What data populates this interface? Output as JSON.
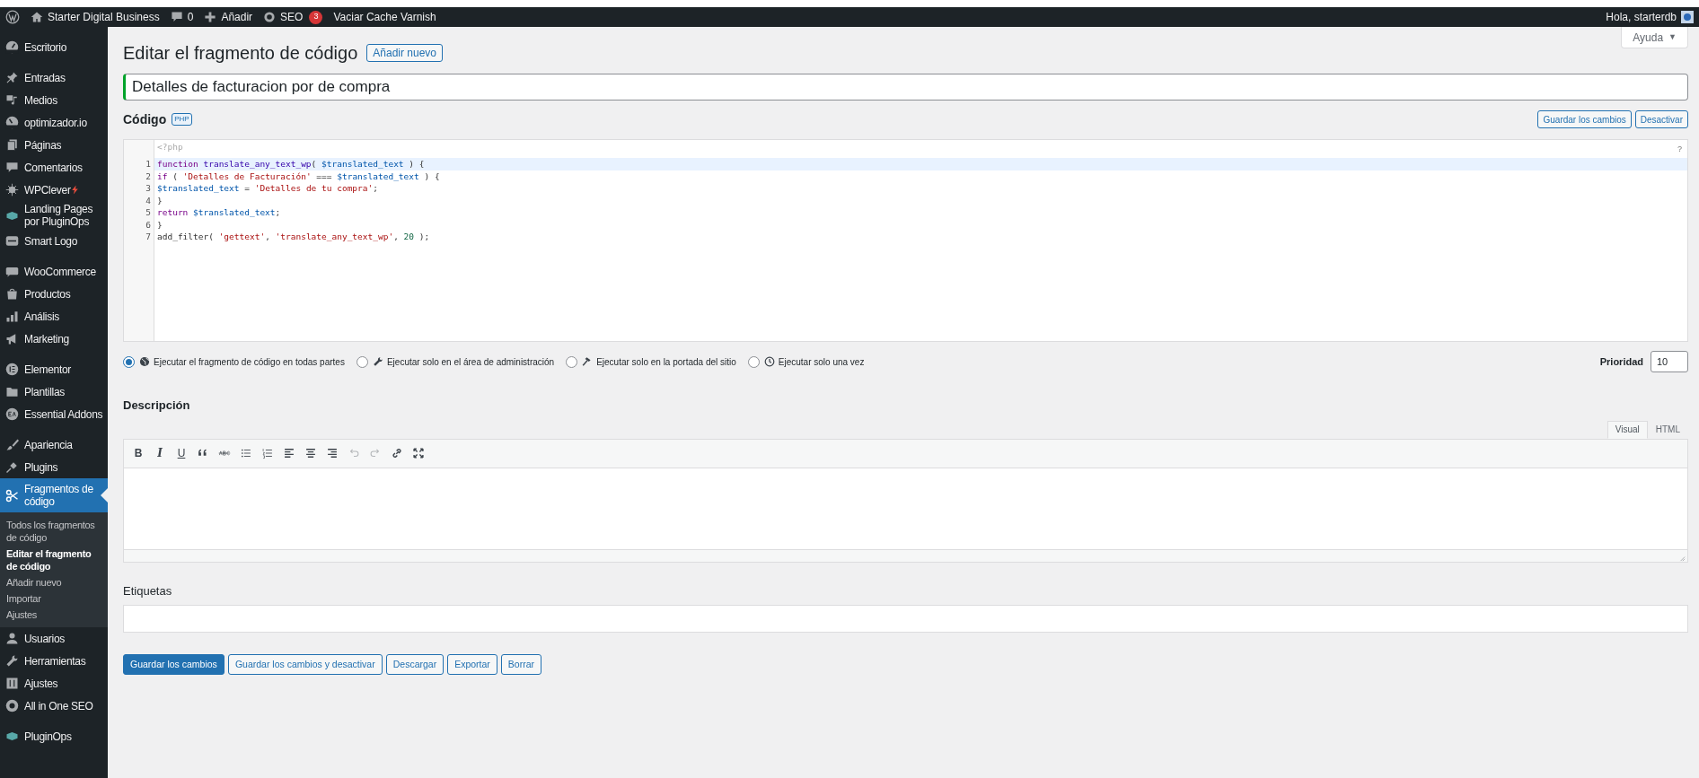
{
  "admin_bar": {
    "site": "Starter Digital Business",
    "comments": "0",
    "new": "Añadir",
    "seo": "SEO",
    "seo_badge": "3",
    "cache": "Vaciar Cache Varnish",
    "greeting": "Hola, starterdb"
  },
  "sidebar": {
    "groups": [
      [
        {
          "label": "Escritorio",
          "selected": false
        }
      ],
      [
        {
          "label": "Entradas",
          "selected": false
        },
        {
          "label": "Medios",
          "selected": false
        },
        {
          "label": "optimizador.io",
          "selected": false
        },
        {
          "label": "Páginas",
          "selected": false
        },
        {
          "label": "Comentarios",
          "selected": false
        },
        {
          "label": "WPClever",
          "selected": false
        },
        {
          "label": "Landing Pages por PluginOps",
          "selected": false
        },
        {
          "label": "Smart Logo",
          "selected": false
        }
      ],
      [
        {
          "label": "WooCommerce",
          "selected": false
        },
        {
          "label": "Productos",
          "selected": false
        },
        {
          "label": "Análisis",
          "selected": false
        },
        {
          "label": "Marketing",
          "selected": false
        }
      ],
      [
        {
          "label": "Elementor",
          "selected": false
        },
        {
          "label": "Plantillas",
          "selected": false
        },
        {
          "label": "Essential Addons",
          "selected": false
        }
      ],
      [
        {
          "label": "Apariencia",
          "selected": false
        },
        {
          "label": "Plugins",
          "selected": false
        },
        {
          "label": "Fragmentos de código",
          "selected": true,
          "children": [
            {
              "label": "Todos los fragmentos de código",
              "selected": false
            },
            {
              "label": "Editar el fragmento de código",
              "selected": true
            },
            {
              "label": "Añadir nuevo",
              "selected": false
            },
            {
              "label": "Importar",
              "selected": false
            },
            {
              "label": "Ajustes",
              "selected": false
            }
          ]
        },
        {
          "label": "Usuarios",
          "selected": false
        },
        {
          "label": "Herramientas",
          "selected": false
        },
        {
          "label": "Ajustes",
          "selected": false
        },
        {
          "label": "All in One SEO",
          "selected": false
        }
      ],
      [
        {
          "label": "PluginOps",
          "selected": false
        }
      ]
    ]
  },
  "help_tab": {
    "label": "Ayuda",
    "caret": "▼"
  },
  "page": {
    "title": "Editar el fragmento de código",
    "add_new": "Añadir nuevo"
  },
  "snippet_title": "Detalles de facturacion por de compra",
  "code": {
    "heading": "Código",
    "badge": "PHP",
    "buttons": [
      "Guardar los cambios",
      "Desactivar"
    ],
    "prefix": "<?php",
    "help": "?",
    "lines": [
      {
        "number": "1",
        "highlighted": true,
        "tokens": [
          {
            "kind": "keyword",
            "text": "function"
          },
          {
            "kind": "def",
            "text": " translate_any_text_wp"
          },
          {
            "kind": "plain",
            "text": "( "
          },
          {
            "kind": "variable",
            "text": "$translated_text"
          },
          {
            "kind": "plain",
            "text": " ) {"
          }
        ]
      },
      {
        "number": "2",
        "highlighted": false,
        "tokens": [
          {
            "kind": "keyword",
            "text": "if"
          },
          {
            "kind": "plain",
            "text": " ( "
          },
          {
            "kind": "string",
            "text": "'Detalles de Facturación'"
          },
          {
            "kind": "plain",
            "text": " === "
          },
          {
            "kind": "variable",
            "text": "$translated_text"
          },
          {
            "kind": "plain",
            "text": " ) {"
          }
        ]
      },
      {
        "number": "3",
        "highlighted": false,
        "tokens": [
          {
            "kind": "variable",
            "text": "$translated_text"
          },
          {
            "kind": "plain",
            "text": " = "
          },
          {
            "kind": "string",
            "text": "'Detalles de tu compra'"
          },
          {
            "kind": "plain",
            "text": ";"
          }
        ]
      },
      {
        "number": "4",
        "highlighted": false,
        "tokens": [
          {
            "kind": "plain",
            "text": "}"
          }
        ]
      },
      {
        "number": "5",
        "highlighted": false,
        "tokens": [
          {
            "kind": "keyword",
            "text": "return"
          },
          {
            "kind": "variable",
            "text": " $translated_text"
          },
          {
            "kind": "plain",
            "text": ";"
          }
        ]
      },
      {
        "number": "6",
        "highlighted": false,
        "tokens": [
          {
            "kind": "plain",
            "text": "}"
          }
        ]
      },
      {
        "number": "7",
        "highlighted": false,
        "tokens": [
          {
            "kind": "plain",
            "text": "add_filter( "
          },
          {
            "kind": "string",
            "text": "'gettext'"
          },
          {
            "kind": "plain",
            "text": ", "
          },
          {
            "kind": "string",
            "text": "'translate_any_text_wp'"
          },
          {
            "kind": "plain",
            "text": ", "
          },
          {
            "kind": "number",
            "text": "20"
          },
          {
            "kind": "plain",
            "text": " );"
          }
        ]
      }
    ]
  },
  "scope": {
    "options": [
      {
        "label": "Ejecutar el fragmento de código en todas partes",
        "selected": true
      },
      {
        "label": "Ejecutar solo en el área de administración",
        "selected": false
      },
      {
        "label": "Ejecutar solo en la portada del sitio",
        "selected": false
      },
      {
        "label": "Ejecutar solo una vez",
        "selected": false
      }
    ],
    "priority_label": "Prioridad",
    "priority": "10"
  },
  "description": {
    "heading": "Descripción",
    "tabs": [
      {
        "label": "Visual",
        "selected": true
      },
      {
        "label": "HTML",
        "selected": false
      }
    ],
    "toolbar": [
      {
        "kind": "text",
        "label": "B",
        "disabled": false
      },
      {
        "kind": "text",
        "label": "I",
        "disabled": false
      },
      {
        "kind": "text",
        "label": "U",
        "disabled": false
      },
      {
        "kind": "quote",
        "disabled": false
      },
      {
        "kind": "strike",
        "disabled": false
      },
      {
        "kind": "ul",
        "disabled": false
      },
      {
        "kind": "ol",
        "disabled": false
      },
      {
        "kind": "align-left",
        "disabled": false
      },
      {
        "kind": "align-center",
        "disabled": false
      },
      {
        "kind": "align-right",
        "disabled": false
      },
      {
        "kind": "undo",
        "disabled": true
      },
      {
        "kind": "redo",
        "disabled": true
      },
      {
        "kind": "link",
        "disabled": false
      },
      {
        "kind": "fullscreen",
        "disabled": false
      }
    ]
  },
  "tags": {
    "heading": "Etiquetas"
  },
  "actions": [
    {
      "label": "Guardar los cambios",
      "kind": "primary"
    },
    {
      "label": "Guardar los cambios y desactivar",
      "kind": "secondary"
    },
    {
      "label": "Descargar",
      "kind": "secondary"
    },
    {
      "label": "Exportar",
      "kind": "secondary"
    },
    {
      "label": "Borrar",
      "kind": "secondary"
    }
  ]
}
